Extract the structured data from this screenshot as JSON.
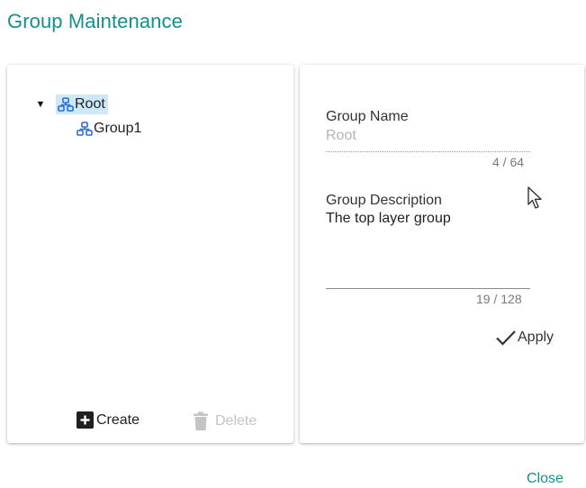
{
  "title": "Group Maintenance",
  "tree": {
    "root": {
      "label": "Root",
      "expanded": true,
      "selected": true,
      "icon": "group-icon"
    },
    "children": [
      {
        "label": "Group1",
        "icon": "group-icon"
      }
    ]
  },
  "left_actions": {
    "create_label": "Create",
    "delete_label": "Delete"
  },
  "form": {
    "group_name": {
      "label": "Group Name",
      "value": "Root",
      "count": "4 / 64"
    },
    "group_description": {
      "label": "Group Description",
      "value": "The top layer group",
      "count": "19 / 128"
    },
    "apply_label": "Apply"
  },
  "footer": {
    "close_label": "Close"
  },
  "colors": {
    "accent": "#138f8c",
    "selection": "#cde9f7",
    "icon_blue": "#2f6fd0"
  }
}
